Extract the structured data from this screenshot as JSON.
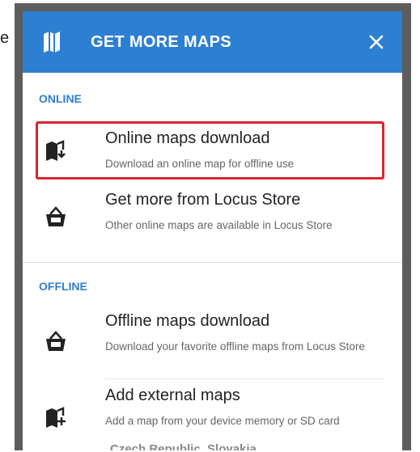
{
  "edge_text": "e",
  "dialog": {
    "title": "GET MORE MAPS",
    "icons": {
      "header": "map-icon",
      "close": "close-icon"
    }
  },
  "sections": {
    "online": {
      "label": "ONLINE",
      "items": [
        {
          "title": "Online maps download",
          "subtitle": "Download an online map for offline use",
          "icon": "map-download-icon"
        },
        {
          "title": "Get more from Locus Store",
          "subtitle": "Other online maps are available in Locus Store",
          "icon": "store-basket-icon"
        }
      ]
    },
    "offline": {
      "label": "OFFLINE",
      "items": [
        {
          "title": "Offline maps download",
          "subtitle": "Download your favorite offline maps from Locus Store",
          "icon": "store-basket-icon"
        },
        {
          "title": "Add external maps",
          "subtitle": "Add a map from your device memory or SD card",
          "icon": "map-add-icon"
        }
      ]
    }
  },
  "background_peek_text": "Czech Republic, Slovakia",
  "colors": {
    "header": "#2d7fd2",
    "accent": "#2d7fd2",
    "highlight": "#d9262d",
    "backdrop": "#5d5d5d"
  }
}
